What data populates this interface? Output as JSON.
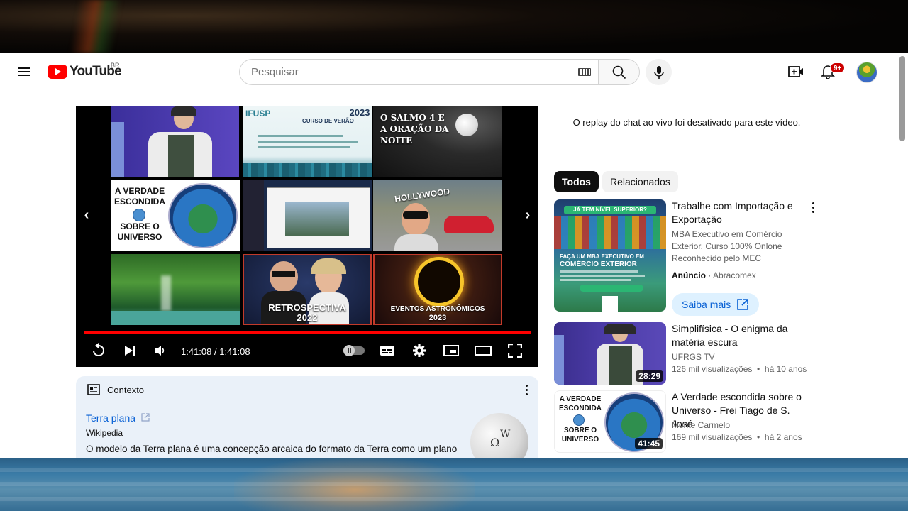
{
  "masthead": {
    "logo_text": "YouTube",
    "country_code": "BR",
    "search_placeholder": "Pesquisar",
    "notification_count": "9+"
  },
  "player": {
    "time_display": "1:41:08 / 1:41:08",
    "progress_fraction": 1.0,
    "endscreen": {
      "tile_ifusp_org": "IFUSP",
      "tile_ifusp_title": "CURSO DE VERÃO",
      "tile_ifusp_year": "2023",
      "tile_salmo": "O SALMO 4 E A ORAÇÃO DA NOITE",
      "tile_verdade_line1": "A VERDADE ESCONDIDA",
      "tile_verdade_line2": "SOBRE O UNIVERSO",
      "tile_retro_title": "RETROSPECTIVA",
      "tile_retro_year": "2022",
      "tile_eventos_title": "EVENTOS ASTRONÔMICOS",
      "tile_eventos_year": "2023"
    }
  },
  "context": {
    "heading": "Contexto",
    "link_text": "Terra plana",
    "source": "Wikipedia",
    "body": "O modelo da Terra plana é uma concepção arcaica do formato da Terra como um plano ou"
  },
  "chat": {
    "message": "O replay do chat ao vivo foi desativado para este vídeo."
  },
  "chips": {
    "all": "Todos",
    "related": "Relacionados"
  },
  "recommendations": [
    {
      "title": "Trabalhe com Importação e Exportação",
      "description": "MBA Executivo em Comércio Exterior. Curso 100% Onlone Reconhecido pelo MEC",
      "ad_label": "Anúncio",
      "advertiser": "· Abracomex",
      "cta": "Saiba mais",
      "thumb_banner": "JÁ TEM NÍVEL SUPERIOR?",
      "thumb_headline": "FAÇA UM MBA EXECUTIVO EM",
      "thumb_subject": "COMÉRCIO EXTERIOR"
    },
    {
      "title": "Simplifísica - O enigma da matéria escura",
      "channel": "UFRGS TV",
      "stats": "126 mil visualizações  •  há 10 anos",
      "duration": "28:29"
    },
    {
      "title": "A Verdade escondida sobre o Universo - Frei Tiago de S. José",
      "channel": "Monte Carmelo",
      "stats": "169 mil visualizações  •  há 2 anos",
      "duration": "41:45",
      "thumb_line1": "A VERDADE ESCONDIDA",
      "thumb_line2": "SOBRE O UNIVERSO"
    }
  ],
  "colors": {
    "brand_red": "#ff0000",
    "link_blue": "#065fd4",
    "context_bg": "#eaf1f9"
  },
  "icons": [
    "menu-icon",
    "youtube-logo-icon",
    "keyboard-icon",
    "search-icon",
    "mic-icon",
    "create-icon",
    "bell-icon",
    "replay-icon",
    "next-icon",
    "volume-icon",
    "autoplay-toggle",
    "subtitles-icon",
    "settings-icon",
    "miniplayer-icon",
    "theater-icon",
    "fullscreen-icon",
    "context-icon",
    "more-vert-icon",
    "external-link-icon"
  ]
}
